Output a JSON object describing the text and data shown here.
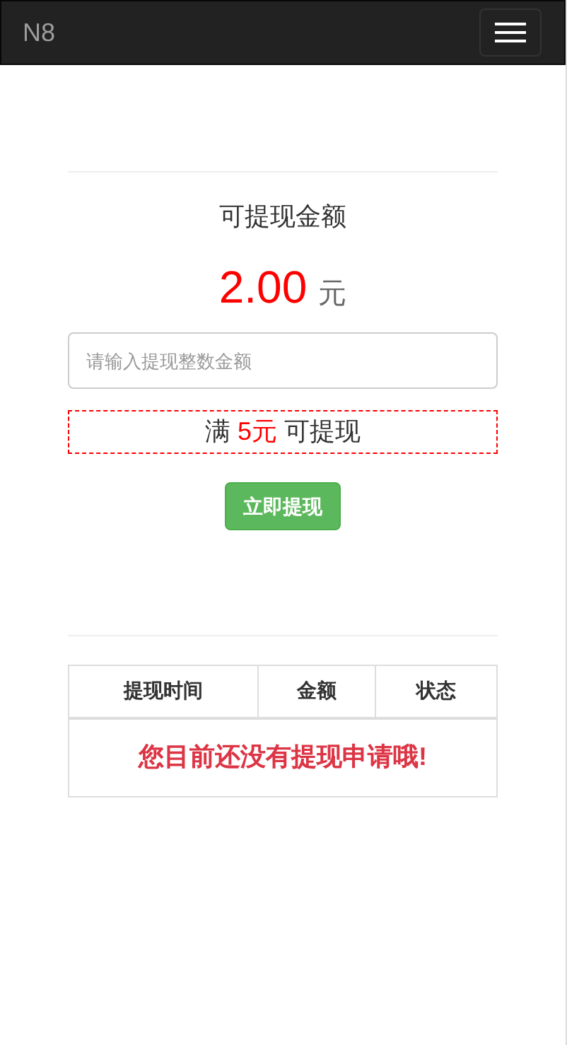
{
  "navbar": {
    "brand": "N8"
  },
  "balance": {
    "label": "可提现金额",
    "amount": "2.00",
    "unit": "元"
  },
  "withdraw_input": {
    "placeholder": "请输入提现整数金额"
  },
  "minimum_note": {
    "prefix": "满",
    "amount": "5元",
    "suffix": "可提现"
  },
  "submit_button": {
    "label": "立即提现"
  },
  "table": {
    "columns": [
      "提现时间",
      "金额",
      "状态"
    ],
    "empty_message": "您目前还没有提现申请哦!"
  }
}
